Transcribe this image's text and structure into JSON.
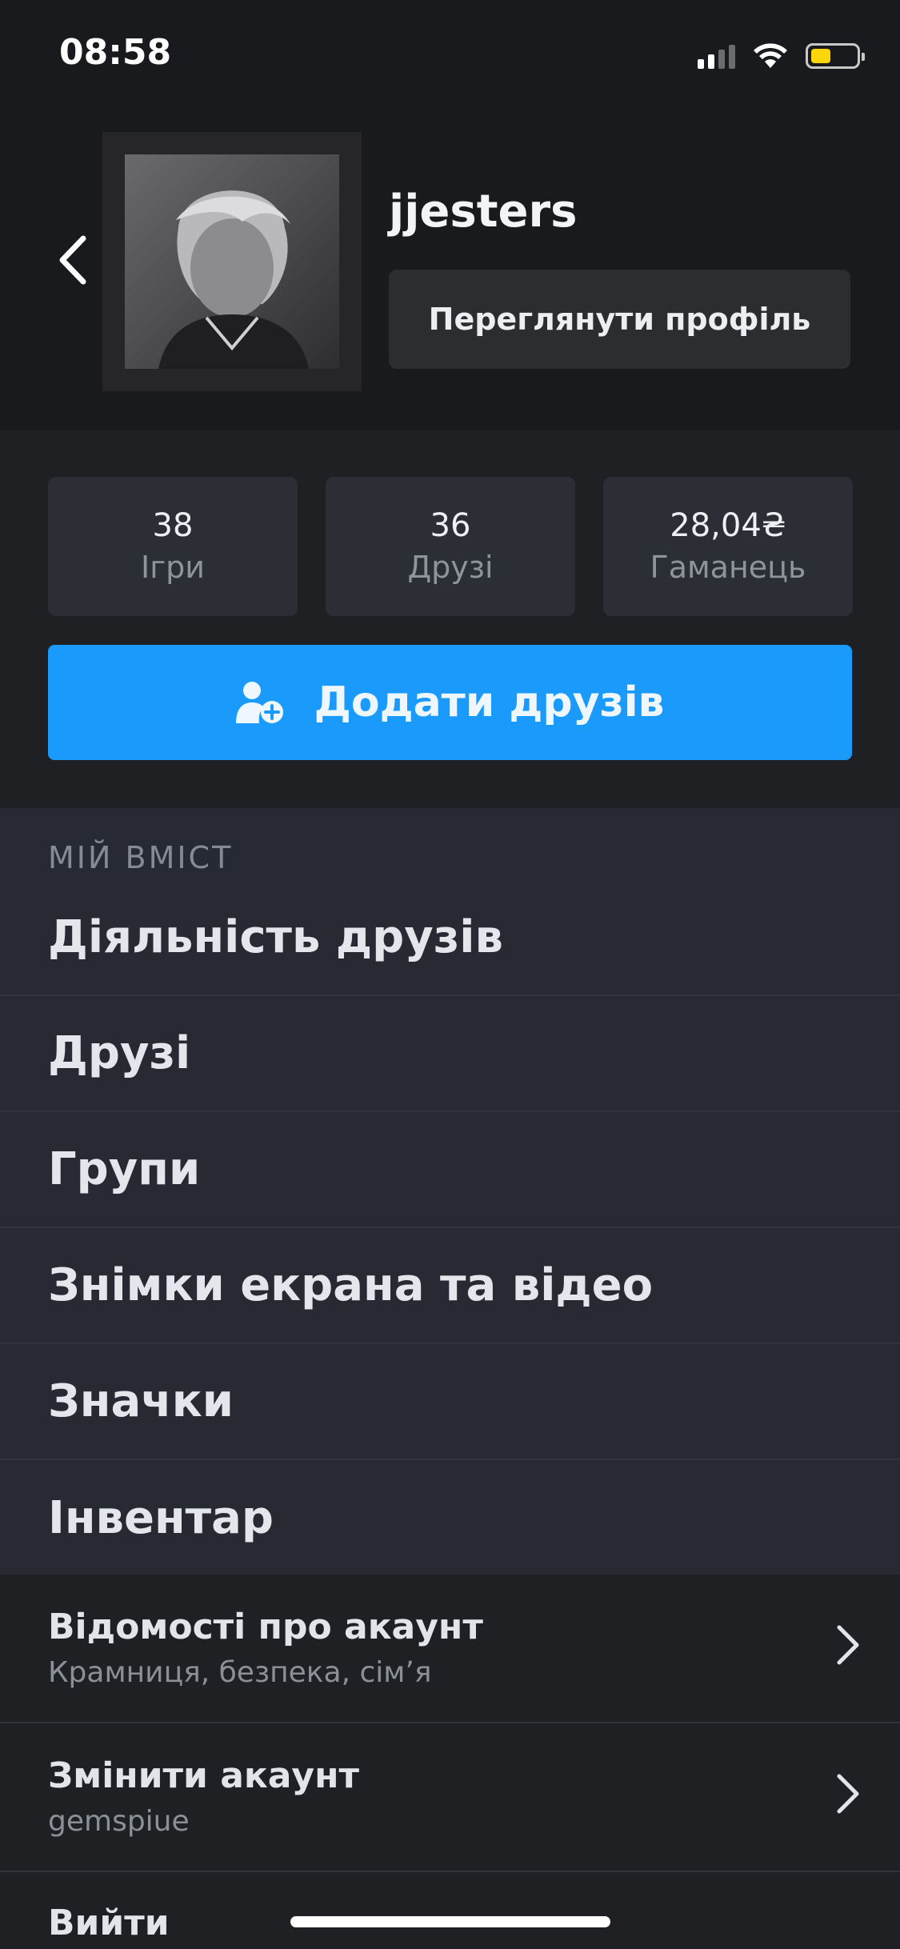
{
  "status_bar": {
    "time": "08:58",
    "battery_level": 0.45
  },
  "profile": {
    "username": "jjesters",
    "view_profile_label": "Переглянути профіль"
  },
  "stats": [
    {
      "value": "38",
      "label": "Ігри"
    },
    {
      "value": "36",
      "label": "Друзі"
    },
    {
      "value": "28,04₴",
      "label": "Гаманець"
    }
  ],
  "add_friends_label": "Додати друзів",
  "my_content": {
    "title": "МІЙ ВМІСТ",
    "items": [
      "Діяльність друзів",
      "Друзі",
      "Групи",
      "Знімки екрана та відео",
      "Значки",
      "Інвентар"
    ]
  },
  "account": {
    "details_title": "Відомості про акаунт",
    "details_sub": "Крамниця, безпека, сім’я",
    "switch_title": "Змінити акаунт",
    "switch_sub": "gemspiue",
    "logout": "Вийти"
  },
  "colors": {
    "accent": "#1a9bfc",
    "background": "#1e2024",
    "list_background": "#272a32",
    "battery": "#ffd60a"
  },
  "icons": [
    "chevron-left-icon",
    "add-friend-icon",
    "chevron-right-icon",
    "signal-icon",
    "wifi-icon",
    "battery-icon"
  ]
}
